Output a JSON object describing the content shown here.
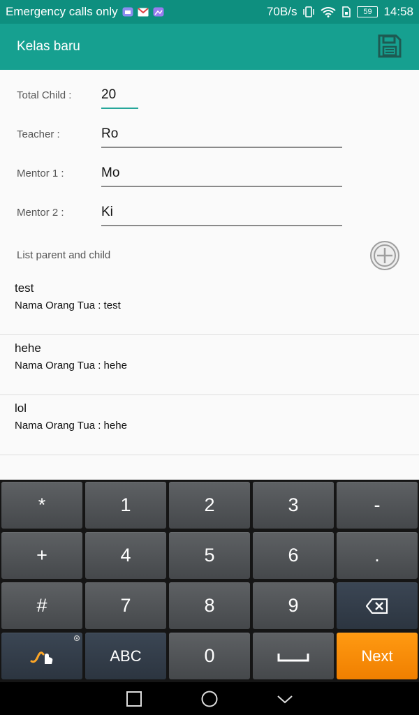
{
  "status_bar": {
    "carrier_text": "Emergency calls only",
    "speed": "70B/s",
    "battery": "59",
    "time": "14:58"
  },
  "app_bar": {
    "title": "Kelas baru",
    "save_icon": "save-icon"
  },
  "form": {
    "total_child": {
      "label": "Total Child :",
      "value": "20"
    },
    "teacher": {
      "label": "Teacher :",
      "value": "Ro"
    },
    "mentor1": {
      "label": "Mentor 1 :",
      "value": "Mo"
    },
    "mentor2": {
      "label": "Mentor 2 :",
      "value": "Ki"
    }
  },
  "list": {
    "header": "List parent and child",
    "add_icon": "add-circle-icon",
    "items": [
      {
        "name": "test",
        "parent": "Nama Orang Tua : test"
      },
      {
        "name": "hehe",
        "parent": "Nama Orang Tua : hehe"
      },
      {
        "name": "lol",
        "parent": "Nama Orang Tua : hehe"
      }
    ]
  },
  "keyboard": {
    "rows": [
      [
        "*",
        "1",
        "2",
        "3",
        "-"
      ],
      [
        "+",
        "4",
        "5",
        "6",
        "."
      ],
      [
        "#",
        "7",
        "8",
        "9",
        "backspace"
      ],
      [
        "swype",
        "ABC",
        "0",
        "space",
        "Next"
      ]
    ]
  },
  "colors": {
    "status_bar": "#0e8f7f",
    "app_bar": "#16a090",
    "accent": "#26a69a",
    "next_key": "#f78e00"
  }
}
